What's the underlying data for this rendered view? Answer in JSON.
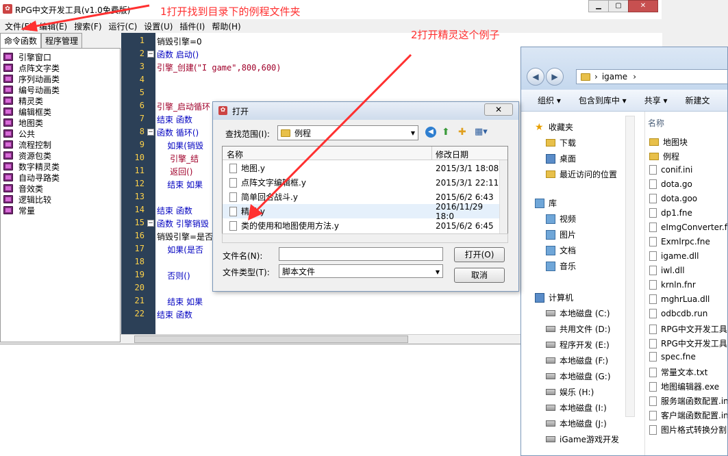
{
  "app": {
    "title": "RPG中文开发工具(v1.0免费版)"
  },
  "menu": [
    "文件(F)",
    "编辑(E)",
    "搜索(F)",
    "运行(C)",
    "设置(U)",
    "插件(I)",
    "帮助(H)"
  ],
  "left_tabs": [
    "命令函数",
    "程序管理"
  ],
  "left_items": [
    "引擎窗口",
    "点阵文字类",
    "序列动画类",
    "编号动画类",
    "精灵类",
    "编辑框类",
    "地图类",
    "公共",
    "流程控制",
    "资源包类",
    "数字精灵类",
    "自动寻路类",
    "音效类",
    "逻辑比较",
    "常量"
  ],
  "code_lines": [
    {
      "n": "1",
      "fold": "",
      "t": "销毁引擎=0",
      "k": "plain"
    },
    {
      "n": "2",
      "fold": "−",
      "t": "函数 启动()",
      "k": "kw"
    },
    {
      "n": "3",
      "fold": "",
      "t": "引擎_创建(",
      "k": "fn",
      "s": "\"I game\",800,600)"
    },
    {
      "n": "4",
      "fold": "",
      "t": "",
      "k": "plain"
    },
    {
      "n": "5",
      "fold": "",
      "t": "",
      "k": "plain"
    },
    {
      "n": "6",
      "fold": "",
      "t": "引擎_启动循环",
      "k": "fn"
    },
    {
      "n": "7",
      "fold": "",
      "t": "结束 函数",
      "k": "kw"
    },
    {
      "n": "8",
      "fold": "−",
      "t": "函数 循环()",
      "k": "kw"
    },
    {
      "n": "9",
      "fold": "",
      "t": "    如果(销毁",
      "k": "kw"
    },
    {
      "n": "10",
      "fold": "",
      "t": "     引擎_结",
      "k": "fn"
    },
    {
      "n": "11",
      "fold": "",
      "t": "     返回()",
      "k": "fn"
    },
    {
      "n": "12",
      "fold": "",
      "t": "    结束 如果",
      "k": "kw"
    },
    {
      "n": "13",
      "fold": "",
      "t": "",
      "k": "plain"
    },
    {
      "n": "14",
      "fold": "",
      "t": "结束 函数",
      "k": "kw"
    },
    {
      "n": "15",
      "fold": "−",
      "t": "函数 引擎销毁",
      "k": "kw"
    },
    {
      "n": "16",
      "fold": "",
      "t": "销毁引擎=是否",
      "k": "plain"
    },
    {
      "n": "17",
      "fold": "",
      "t": "    如果(是否",
      "k": "kw"
    },
    {
      "n": "18",
      "fold": "",
      "t": "",
      "k": "plain"
    },
    {
      "n": "19",
      "fold": "",
      "t": "    否则()",
      "k": "kw"
    },
    {
      "n": "20",
      "fold": "",
      "t": "",
      "k": "plain"
    },
    {
      "n": "21",
      "fold": "",
      "t": "    结束 如果",
      "k": "kw"
    },
    {
      "n": "22",
      "fold": "",
      "t": "结束 函数",
      "k": "kw"
    }
  ],
  "annotations": {
    "a1": "1打开找到目录下的例程文件夹",
    "a2": "2打开精灵这个例子"
  },
  "dialog": {
    "title": "打开",
    "lookin_label": "查找范围(I):",
    "lookin_value": "例程",
    "col_name": "名称",
    "col_date": "修改日期",
    "files": [
      {
        "name": "地图.y",
        "date": "2015/3/1 18:08"
      },
      {
        "name": "点阵文字编辑框.y",
        "date": "2015/3/1 22:11"
      },
      {
        "name": "简单回合战斗.y",
        "date": "2015/6/2 6:43"
      },
      {
        "name": "精灵.y",
        "date": "2016/11/29 18:0"
      },
      {
        "name": "类的使用和地图使用方法.y",
        "date": "2015/6/2 6:45"
      }
    ],
    "filename_label": "文件名(N):",
    "filetype_label": "文件类型(T):",
    "filetype_value": "脚本文件",
    "open_button": "打开(O)",
    "cancel_button": "取消"
  },
  "explorer": {
    "path": "igame",
    "toolbar": [
      "组织 ▾",
      "包含到库中 ▾",
      "共享 ▾",
      "新建文"
    ],
    "nav": [
      "收藏夹",
      "下载",
      "桌面",
      "最近访问的位置",
      "库",
      "视频",
      "图片",
      "文档",
      "音乐",
      "计算机",
      "本地磁盘 (C:)",
      "共用文件 (D:)",
      "程序开发 (E:)",
      "本地磁盘 (F:)",
      "本地磁盘 (G:)",
      "娱乐 (H:)",
      "本地磁盘 (I:)",
      "本地磁盘 (J:)",
      "iGame游戏开发"
    ],
    "col_name": "名称",
    "files": [
      "地图块",
      "例程",
      "conif.ini",
      "dota.go",
      "dota.goo",
      "dp1.fne",
      "eImgConverter.fr",
      "Exmlrpc.fne",
      "igame.dll",
      "iwl.dll",
      "krnln.fnr",
      "mghrLua.dll",
      "odbcdb.run",
      "RPG中文开发工具.",
      "RPG中文开发工具.",
      "spec.fne",
      "常量文本.txt",
      "地图编辑器.exe",
      "服务端函数配置.in",
      "客户端函数配置.in",
      "图片格式转换分割"
    ]
  },
  "colors": {
    "gutter": "#2c4057",
    "line_number": "#ffd24a",
    "annotation": "#ff3030"
  }
}
